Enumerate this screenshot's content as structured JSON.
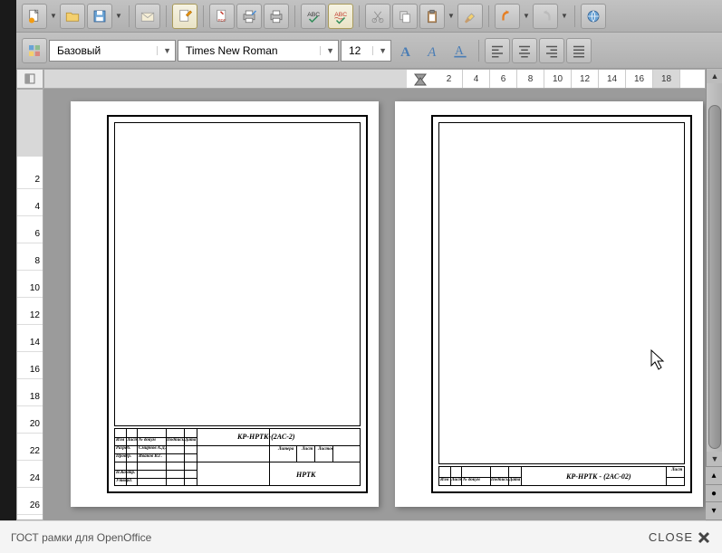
{
  "toolbar": {
    "style": "Базовый",
    "font": "Times New Roman",
    "size": "12"
  },
  "ruler_h": [
    "2",
    "4",
    "6",
    "8",
    "10",
    "12",
    "14",
    "16",
    "18"
  ],
  "ruler_v": [
    "2",
    "4",
    "6",
    "8",
    "10",
    "12",
    "14",
    "16",
    "18",
    "20",
    "22",
    "24",
    "26"
  ],
  "page1": {
    "doc_code": "КР-НРТК-(2АС-2)",
    "org": "НРТК",
    "rows": {
      "r1": "Изм",
      "r2": "Лист",
      "r3": "№ докум",
      "r4": "Подпись",
      "r5": "Дата",
      "r_dev": "Разраб.",
      "r_dev_name": "Смирнов А.Д.",
      "r_check": "Провер.",
      "r_check_name": "Иванов В.Г.",
      "r_ncontr": "Н.Контр.",
      "r_appr": "Утверд.",
      "litera": "Литера",
      "list": "Лист",
      "listov": "Листов"
    }
  },
  "page2": {
    "doc_code": "КР-НРТК - (2АС-02)",
    "r1": "Изм",
    "r2": "Лист",
    "r3": "№ докум",
    "r4": "Подпись",
    "r5": "Дата",
    "list": "Лист"
  },
  "footer": {
    "caption": "ГОСТ рамки для OpenOffice",
    "close": "CLOSE"
  }
}
